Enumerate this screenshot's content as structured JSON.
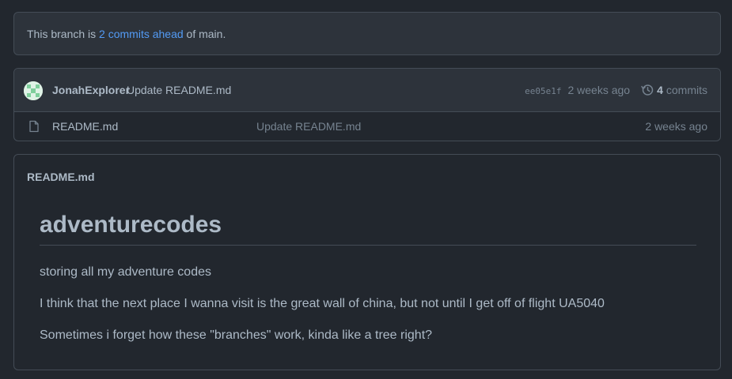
{
  "branch_status": {
    "prefix": "This branch is ",
    "link_text": "2 commits ahead",
    "suffix": " of main."
  },
  "latest_commit": {
    "author": "JonahExplorer",
    "message": "Update README.md",
    "sha": "ee05e1f",
    "time": "2 weeks ago",
    "commit_count": "4",
    "commit_count_label": " commits"
  },
  "files": [
    {
      "name": "README.md",
      "last_commit_message": "Update README.md",
      "time": "2 weeks ago"
    }
  ],
  "readme": {
    "header": "README.md",
    "title": "adventurecodes",
    "paragraphs": [
      "storing all my adventure codes",
      "I think that the next place I wanna visit is the great wall of china, but not until I get off of flight UA5040",
      "Sometimes i forget how these \"branches\" work, kinda like a tree right?"
    ]
  },
  "colors": {
    "background": "#22272e",
    "panel": "#2d333b",
    "border": "#444c56",
    "link": "#539bf5",
    "text": "#adbac7",
    "muted": "#768390"
  },
  "icons": {
    "history": "history-icon",
    "file": "file-icon",
    "avatar": "identicon-avatar"
  }
}
